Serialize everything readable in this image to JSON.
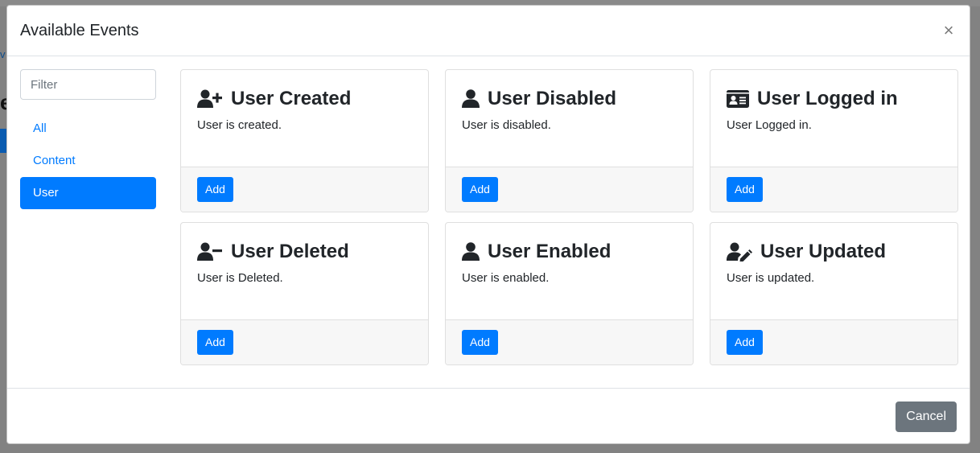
{
  "modal": {
    "title": "Available Events",
    "close_label": "×"
  },
  "sidebar": {
    "filter_placeholder": "Filter",
    "items": [
      {
        "label": "All",
        "active": false
      },
      {
        "label": "Content",
        "active": false
      },
      {
        "label": "User",
        "active": true
      }
    ]
  },
  "events": [
    {
      "title": "User Created",
      "description": "User is created.",
      "icon": "user-plus-icon",
      "button": "Add"
    },
    {
      "title": "User Disabled",
      "description": "User is disabled.",
      "icon": "user-icon",
      "button": "Add"
    },
    {
      "title": "User Logged in",
      "description": "User Logged in.",
      "icon": "id-card-icon",
      "button": "Add"
    },
    {
      "title": "User Deleted",
      "description": "User is Deleted.",
      "icon": "user-minus-icon",
      "button": "Add"
    },
    {
      "title": "User Enabled",
      "description": "User is enabled.",
      "icon": "user-icon",
      "button": "Add"
    },
    {
      "title": "User Updated",
      "description": "User is updated.",
      "icon": "user-edit-icon",
      "button": "Add"
    }
  ],
  "footer": {
    "cancel_label": "Cancel"
  },
  "colors": {
    "primary": "#007bff",
    "secondary": "#6c757d",
    "card_footer": "#f7f7f7"
  }
}
